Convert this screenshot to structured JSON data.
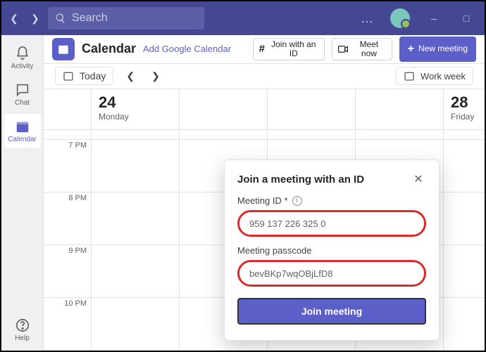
{
  "titlebar": {
    "search_placeholder": "Search"
  },
  "sidebar": {
    "items": [
      {
        "label": "Activity"
      },
      {
        "label": "Chat"
      },
      {
        "label": "Calendar"
      },
      {
        "label": "Help"
      }
    ]
  },
  "toolbar": {
    "page_title": "Calendar",
    "add_google": "Add Google Calendar",
    "join_id": "Join with an ID",
    "meet_now": "Meet now",
    "new_meeting": "New meeting"
  },
  "subbar": {
    "today": "Today",
    "workweek": "Work week"
  },
  "days": [
    {
      "num": "24",
      "name": "Monday"
    },
    {
      "num": "28",
      "name": "Friday"
    }
  ],
  "hours": [
    "7 PM",
    "8 PM",
    "9 PM",
    "10 PM"
  ],
  "modal": {
    "title": "Join a meeting with an ID",
    "meeting_id_label": "Meeting ID *",
    "meeting_id_value": "959 137 226 325 0",
    "passcode_label": "Meeting passcode",
    "passcode_value": "bevBKp7wqOBjLfD8",
    "join_label": "Join meeting"
  }
}
